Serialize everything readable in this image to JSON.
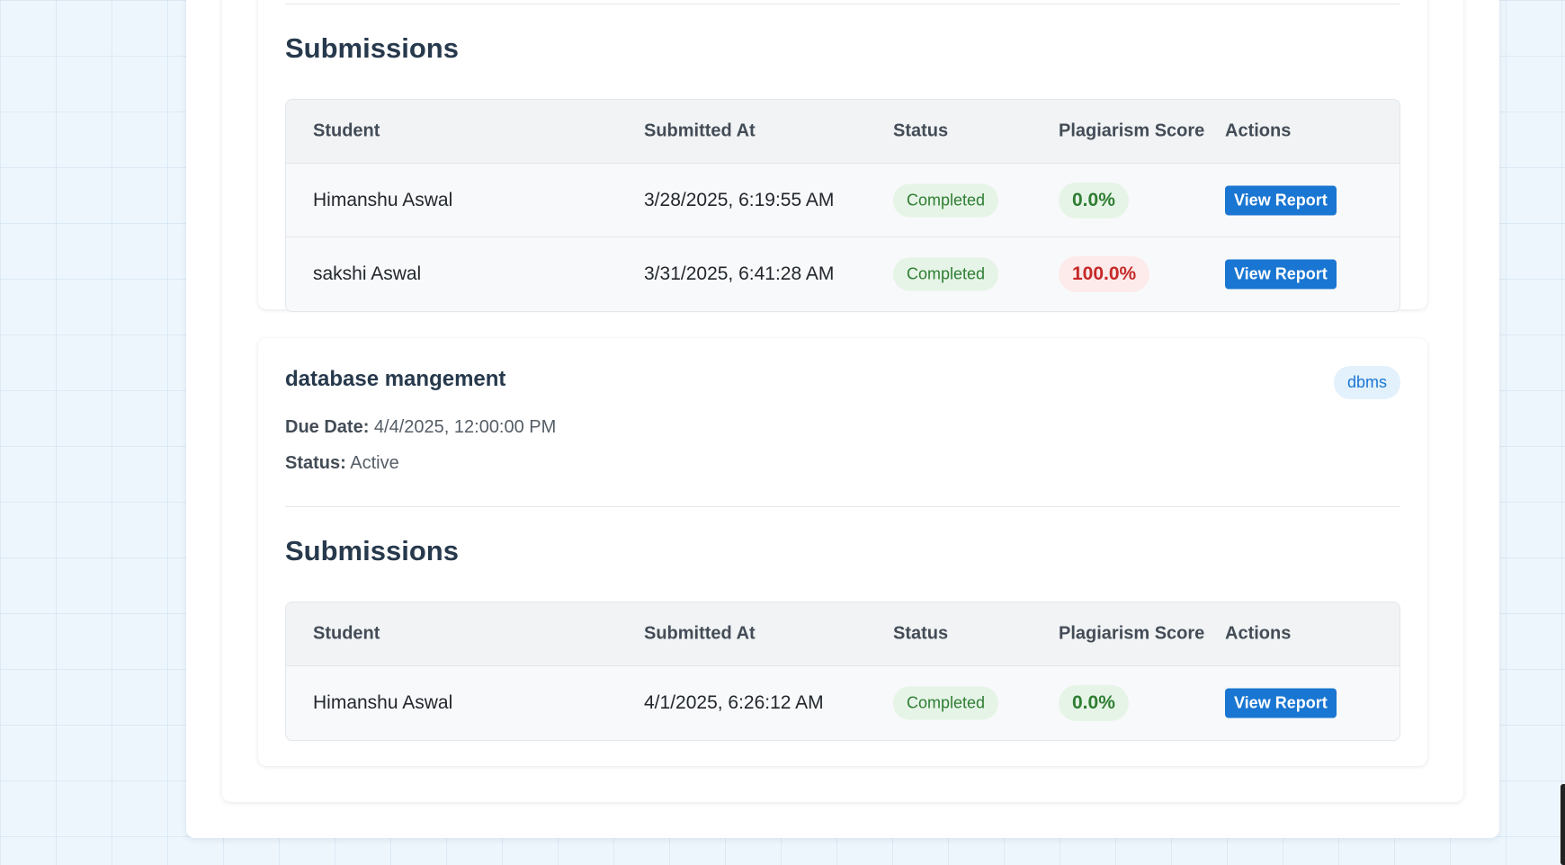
{
  "assignments": [
    {
      "submissions_title": "Submissions",
      "columns": [
        "Student",
        "Submitted At",
        "Status",
        "Plagiarism Score",
        "Actions"
      ],
      "rows": [
        {
          "student": "Himanshu Aswal",
          "submitted_at": "3/28/2025, 6:19:55 AM",
          "status": "Completed",
          "score": "0.0%",
          "action": "View Report"
        },
        {
          "student": "sakshi Aswal",
          "submitted_at": "3/31/2025, 6:41:28 AM",
          "status": "Completed",
          "score": "100.0%",
          "action": "View Report"
        }
      ]
    },
    {
      "title": "database mangement",
      "tag": "dbms",
      "due_label": "Due Date:",
      "due_value": "4/4/2025, 12:00:00 PM",
      "status_label": "Status:",
      "status_value": "Active",
      "submissions_title": "Submissions",
      "columns": [
        "Student",
        "Submitted At",
        "Status",
        "Plagiarism Score",
        "Actions"
      ],
      "rows": [
        {
          "student": "Himanshu Aswal",
          "submitted_at": "4/1/2025, 6:26:12 AM",
          "status": "Completed",
          "score": "0.0%",
          "action": "View Report"
        }
      ]
    }
  ],
  "colors": {
    "primary": "#1976d2",
    "success": "#2e7d32",
    "danger": "#c62828",
    "heading": "#27394c"
  }
}
